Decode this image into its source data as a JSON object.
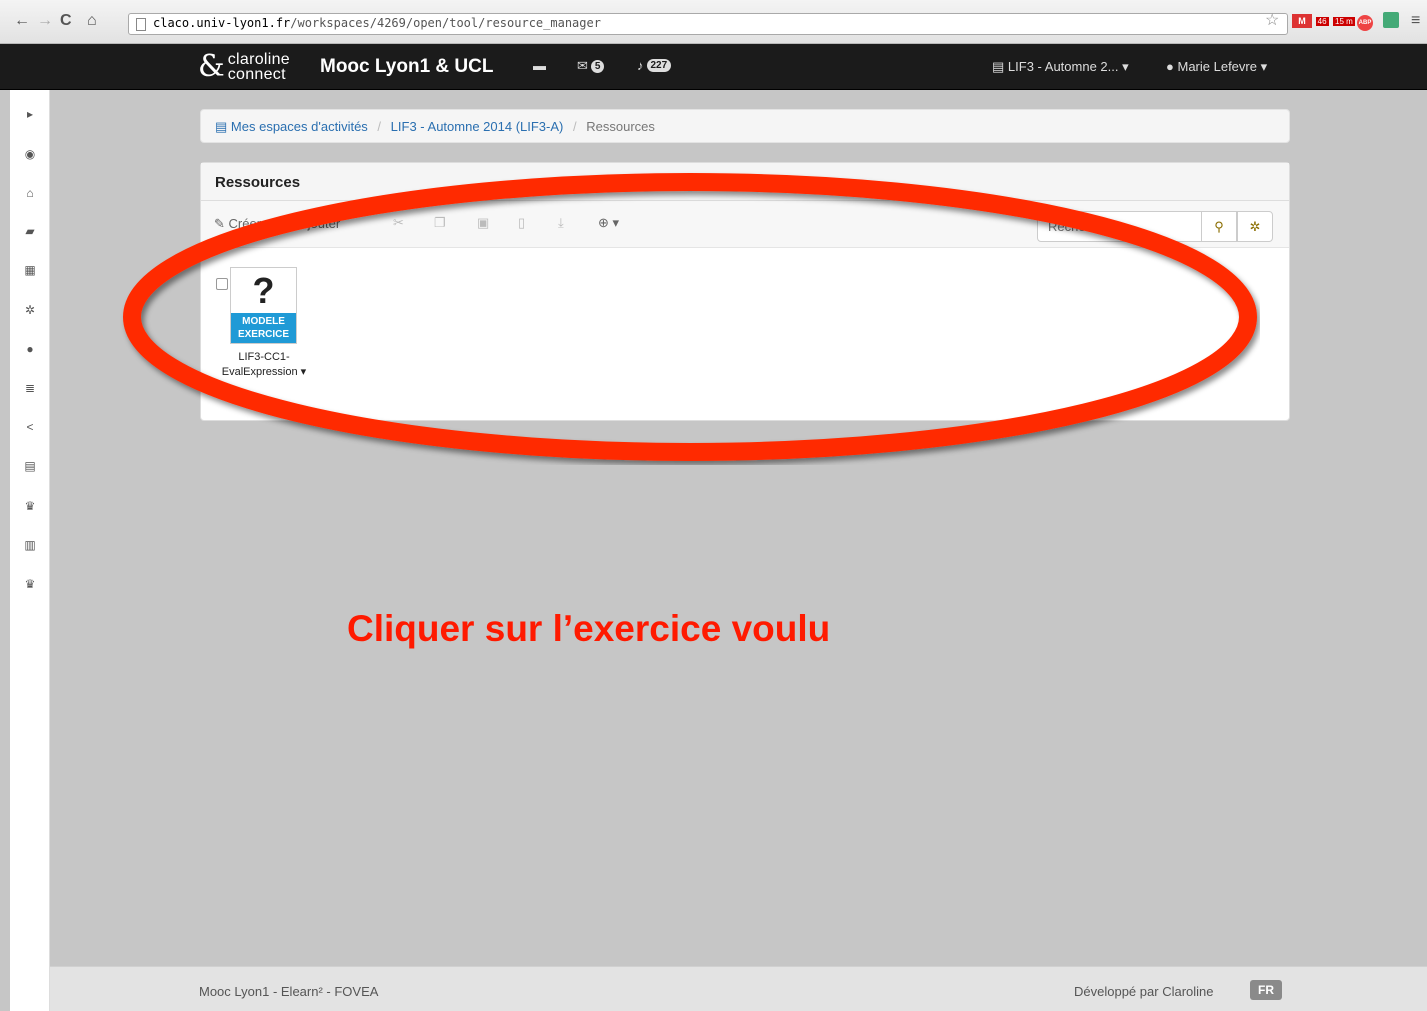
{
  "browser": {
    "url_host": "claco.univ-lyon1.fr",
    "url_path": "/workspaces/4269/open/tool/resource_manager",
    "back_icon": "back-arrow-icon",
    "forward_icon": "forward-arrow-icon",
    "reload_icon": "reload-icon",
    "home_icon": "home-icon",
    "gmail_badge": "46",
    "calendar_badge": "15 m",
    "abp_label": "ABP"
  },
  "navbar": {
    "logo_mark": "&",
    "logo_line1": "claroline",
    "logo_line2": "connect",
    "brand": "Mooc Lyon1 & UCL",
    "messages_count": "5",
    "notifications_count": "227",
    "workspace_menu": "LIF3 - Automne 2...",
    "user_menu": "Marie Lefevre"
  },
  "sidebar": {
    "icons": [
      "expand-icon",
      "eye-icon",
      "home-icon",
      "folder-icon",
      "calendar-icon",
      "gear-icon",
      "user-icon",
      "list-icon",
      "share-icon",
      "table-icon",
      "trophy-icon",
      "chart-icon",
      "trophy-icon"
    ]
  },
  "breadcrumb": {
    "item1": "Mes espaces d'activités",
    "item2": "LIF3 - Automne 2014 (LIF3-A)",
    "item3": "Ressources"
  },
  "panel": {
    "title": "Ressources",
    "create_label": "Créer",
    "add_label": "Ajouter",
    "search_placeholder": "Rechercher",
    "resource": {
      "badge_symbol": "?",
      "badge_line1": "MODELE",
      "badge_line2": "EXERCICE",
      "name_line1": "LIF3-CC1-",
      "name_line2": "EvalExpression"
    }
  },
  "annotation": {
    "text": "Cliquer sur l’exercice voulu",
    "color": "#ff1a00"
  },
  "footer": {
    "left": "Mooc Lyon1 - Elearn² - FOVEA",
    "right_prefix": "Développé par",
    "right_brand": "Claroline",
    "lang": "FR"
  }
}
